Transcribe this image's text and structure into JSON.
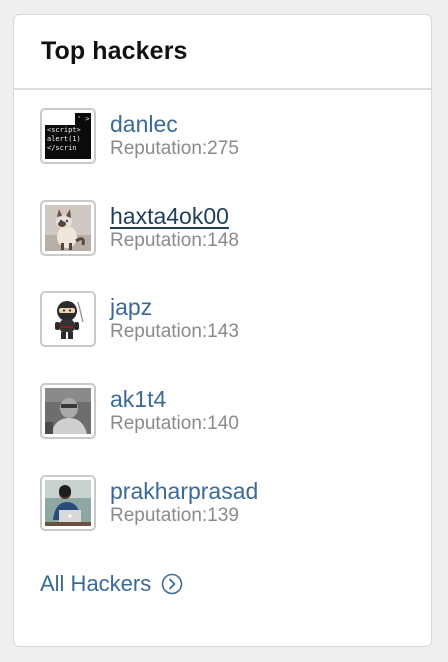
{
  "widget": {
    "title": "Top hackers",
    "all_link_label": "All Hackers"
  },
  "hackers": [
    {
      "name": "danlec",
      "reputation": "Reputation:275",
      "avatar": "code-avatar"
    },
    {
      "name": "haxta4ok00",
      "reputation": "Reputation:148",
      "avatar": "cat-avatar"
    },
    {
      "name": "japz",
      "reputation": "Reputation:143",
      "avatar": "ninja-avatar"
    },
    {
      "name": "ak1t4",
      "reputation": "Reputation:140",
      "avatar": "grayscale-photo-avatar"
    },
    {
      "name": "prakharprasad",
      "reputation": "Reputation:139",
      "avatar": "laptop-photo-avatar"
    }
  ],
  "avatar_code_text": {
    "line1": "' >",
    "line2": "<script>",
    "line3": "alert(1)",
    "line4": "</scrin"
  },
  "colors": {
    "link": "#3b6a98",
    "link_hover": "#1f3d5c",
    "muted": "#8a8a8a",
    "border": "#d8d8d8"
  }
}
